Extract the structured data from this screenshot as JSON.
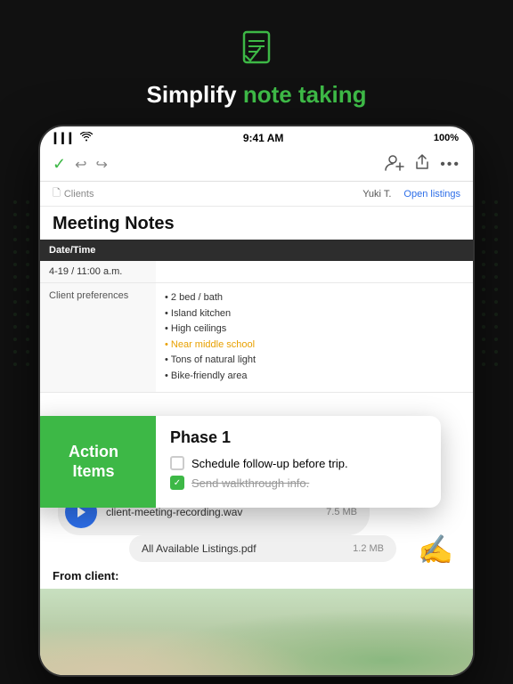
{
  "hero": {
    "title_plain": "Simplify ",
    "title_highlight": "note taking",
    "icon": "📋"
  },
  "status_bar": {
    "signal": "▎▎▎",
    "wifi": "wifi",
    "time": "9:41 AM",
    "battery": "100%"
  },
  "toolbar": {
    "undo_label": "↩",
    "redo_label": "↪"
  },
  "breadcrumb": {
    "path": "Clients",
    "user": "Yuki T.",
    "action": "Open listings"
  },
  "page": {
    "title": "Meeting Notes"
  },
  "table": {
    "headers": [
      "Date/Time",
      ""
    ],
    "row": {
      "date": "4-19 / 11:00 a.m.",
      "value": ""
    }
  },
  "action_items": {
    "label": "Action Items",
    "phase": "Phase 1",
    "tasks": [
      {
        "text": "Schedule follow-up before trip.",
        "done": false,
        "strikethrough": false
      },
      {
        "text": "Send walkthrough info.",
        "done": true,
        "strikethrough": true
      }
    ]
  },
  "preferences": {
    "label": "Client preferences",
    "items": [
      "2 bed / bath",
      "Island kitchen",
      "High ceilings",
      "Near middle school",
      "Tons of natural light",
      "Bike-friendly area"
    ],
    "highlight_item": "Near middle school"
  },
  "files": {
    "audio": {
      "name": "client-meeting-recording.wav",
      "size": "7.5 MB"
    },
    "pdf": {
      "name": "All Available Listings.pdf",
      "size": "1.2 MB"
    }
  },
  "from_client": {
    "label": "From client:"
  }
}
